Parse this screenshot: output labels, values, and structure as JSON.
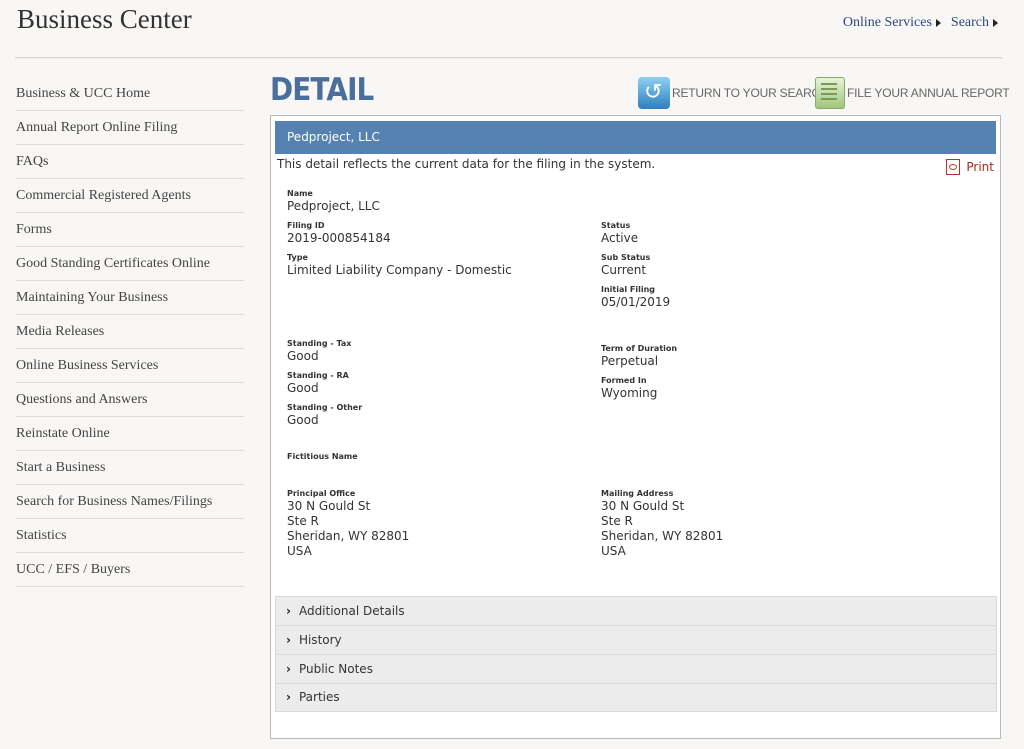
{
  "header": {
    "site_title": "Business Center",
    "links": [
      "Online Services",
      "Search"
    ]
  },
  "sidebar": {
    "items": [
      "Business & UCC Home",
      "Annual Report Online Filing",
      "FAQs",
      "Commercial Registered Agents",
      "Forms",
      "Good Standing Certificates Online",
      "Maintaining Your Business",
      "Media Releases",
      "Online Business Services",
      "Questions and Answers",
      "Reinstate Online",
      "Start a Business",
      "Search for Business Names/Filings",
      "Statistics",
      "UCC / EFS / Buyers"
    ]
  },
  "main": {
    "heading": "DETAIL",
    "return_label": "RETURN TO YOUR SEARCH",
    "file_label": "FILE YOUR ANNUAL REPORT",
    "panel_title": "Pedproject, LLC",
    "intro": "This detail reflects the current data for the filing in the system.",
    "print_label": "Print"
  },
  "fields": {
    "name": {
      "label": "Name",
      "value": "Pedproject, LLC"
    },
    "filing_id": {
      "label": "Filing ID",
      "value": "2019-000854184"
    },
    "type": {
      "label": "Type",
      "value": "Limited Liability Company - Domestic"
    },
    "status": {
      "label": "Status",
      "value": "Active"
    },
    "sub_status": {
      "label": "Sub Status",
      "value": "Current"
    },
    "initial_filing": {
      "label": "Initial Filing",
      "value": "05/01/2019"
    },
    "standing_tax": {
      "label": "Standing - Tax",
      "value": "Good"
    },
    "standing_ra": {
      "label": "Standing - RA",
      "value": "Good"
    },
    "standing_other": {
      "label": "Standing - Other",
      "value": "Good"
    },
    "term_of_duration": {
      "label": "Term of Duration",
      "value": "Perpetual"
    },
    "formed_in": {
      "label": "Formed In",
      "value": "Wyoming"
    },
    "fictitious_name": {
      "label": "Fictitious Name"
    },
    "principal_office": {
      "label": "Principal Office",
      "lines": [
        "30 N Gould St",
        "Ste R",
        "Sheridan, WY 82801",
        "USA"
      ]
    },
    "mailing_address": {
      "label": "Mailing Address",
      "lines": [
        "30 N Gould St",
        "Ste R",
        "Sheridan, WY 82801",
        "USA"
      ]
    }
  },
  "accordion": [
    "Additional Details",
    "History",
    "Public Notes",
    "Parties"
  ]
}
